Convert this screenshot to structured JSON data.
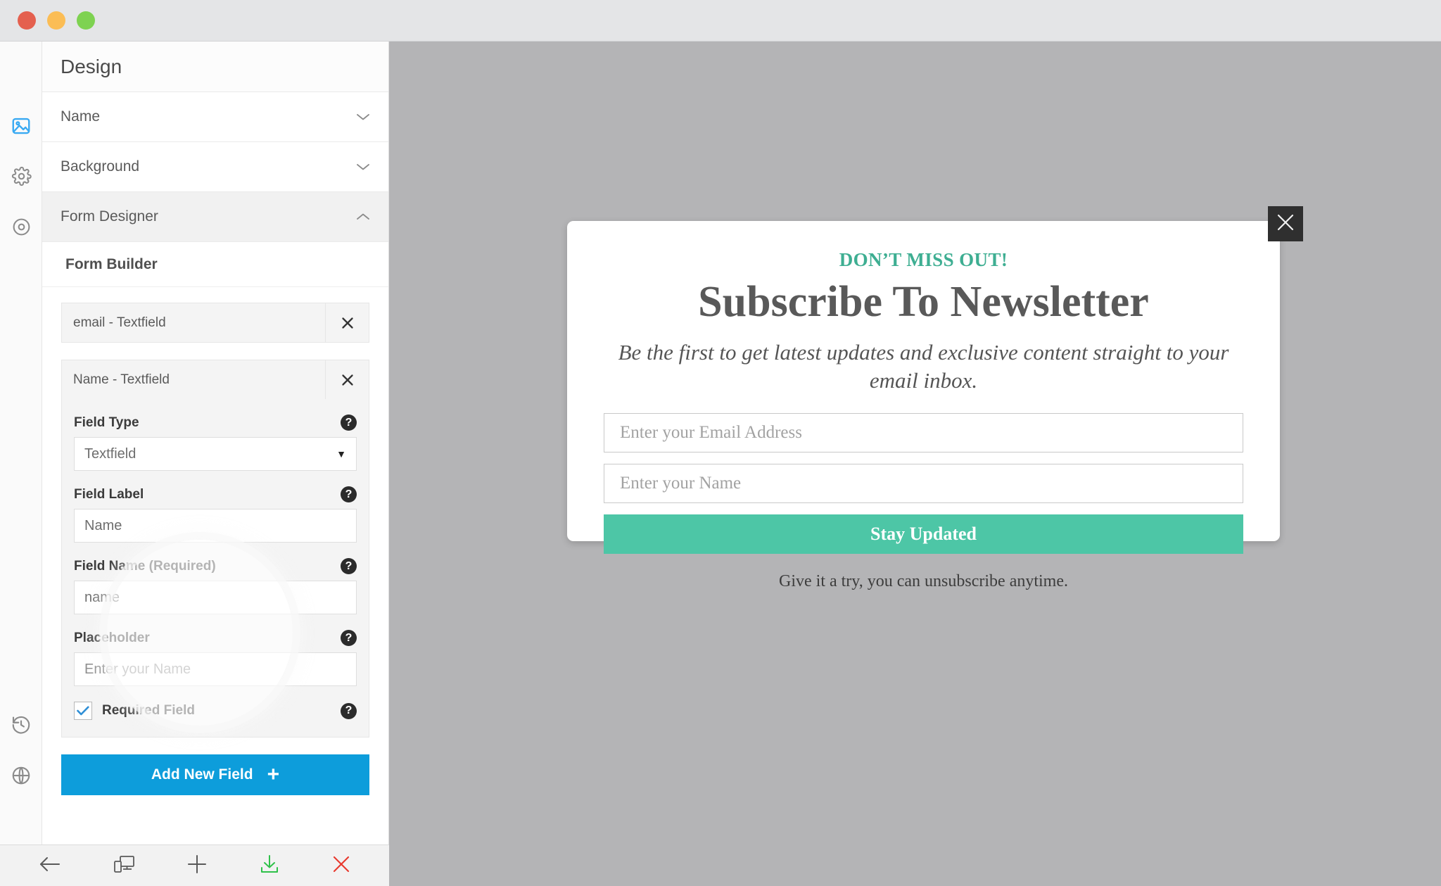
{
  "window": {
    "traffic_lights": [
      "close",
      "minimize",
      "maximize"
    ]
  },
  "rail": {
    "items": [
      {
        "icon": "image-icon",
        "active": true
      },
      {
        "icon": "gear-icon",
        "active": false
      },
      {
        "icon": "target-icon",
        "active": false
      }
    ],
    "bottom_items": [
      {
        "icon": "history-icon"
      },
      {
        "icon": "globe-icon"
      }
    ]
  },
  "panel": {
    "title": "Design",
    "accordions": [
      {
        "label": "Name",
        "expanded": false,
        "chevron": "chevron-down-icon"
      },
      {
        "label": "Background",
        "expanded": false,
        "chevron": "chevron-down-icon"
      },
      {
        "label": "Form Designer",
        "expanded": true,
        "chevron": "chevron-up-icon"
      }
    ],
    "sub_section": "Form Builder",
    "fields": [
      {
        "header": "email - Textfield",
        "remove_icon": "close-icon",
        "expanded": false
      },
      {
        "header": "Name - Textfield",
        "remove_icon": "close-icon",
        "expanded": true,
        "properties": {
          "field_type": {
            "label": "Field Type",
            "value": "Textfield",
            "help_icon": "help-icon",
            "caret": "caret-down-icon"
          },
          "field_label": {
            "label": "Field Label",
            "value": "Name",
            "help_icon": "help-icon"
          },
          "field_name": {
            "label": "Field Name (Required)",
            "value": "name",
            "help_icon": "help-icon"
          },
          "placeholder": {
            "label": "Placeholder",
            "value": "Enter your Name",
            "help_icon": "help-icon"
          },
          "required": {
            "label": "Required Field",
            "checked": true,
            "help_icon": "help-icon",
            "check_icon": "checkmark-icon"
          }
        }
      }
    ],
    "add_field_button": {
      "label": "Add New Field",
      "icon": "plus-icon"
    }
  },
  "bottom_toolbar": {
    "items": [
      {
        "icon": "back-arrow-icon"
      },
      {
        "icon": "responsive-device-icon"
      },
      {
        "icon": "plus-icon"
      },
      {
        "icon": "download-icon"
      },
      {
        "icon": "close-icon"
      }
    ]
  },
  "preview": {
    "popup": {
      "kicker": "DON’T MISS OUT!",
      "title": "Subscribe To Newsletter",
      "subtitle": "Be the first to get latest updates and exclusive content straight to your email inbox.",
      "email_placeholder": "Enter your Email Address",
      "name_placeholder": "Enter your Name",
      "submit_label": "Stay Updated",
      "footnote": "Give it a try, you can unsubscribe anytime.",
      "close_icon": "close-icon"
    }
  },
  "colors": {
    "accent_blue": "#0d9ddb",
    "accent_teal": "#4dc6a6",
    "kicker_teal": "#3eae92",
    "canvas_gray": "#b4b4b6",
    "checkbox_blue": "#2f8fd6",
    "download_green": "#2fc14a",
    "close_red": "#e8392e"
  }
}
